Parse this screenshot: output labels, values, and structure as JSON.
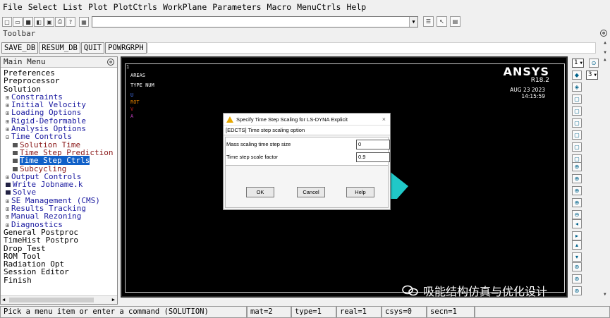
{
  "menubar": {
    "items": [
      "File",
      "Select",
      "List",
      "Plot",
      "PlotCtrls",
      "WorkPlane",
      "Parameters",
      "Macro",
      "MenuCtrls",
      "Help"
    ]
  },
  "toolbar": {
    "label": "Toolbar",
    "buttons": [
      "SAVE_DB",
      "RESUM_DB",
      "QUIT",
      "POWRGRPH"
    ]
  },
  "main_menu": {
    "title": "Main Menu",
    "items": [
      {
        "label": "Preferences",
        "level": 0
      },
      {
        "label": "Preprocessor",
        "level": 0
      },
      {
        "label": "Solution",
        "level": 0
      },
      {
        "label": "Constraints",
        "level": 1,
        "expandable": true
      },
      {
        "label": "Initial Velocity",
        "level": 1,
        "expandable": true
      },
      {
        "label": "Loading Options",
        "level": 1,
        "expandable": true
      },
      {
        "label": "Rigid-Deformable",
        "level": 1,
        "expandable": true
      },
      {
        "label": "Analysis Options",
        "level": 1,
        "expandable": true
      },
      {
        "label": "Time Controls",
        "level": 1,
        "expandable": true,
        "expanded": true
      },
      {
        "label": "Solution Time",
        "level": 2
      },
      {
        "label": "Time Step Prediction",
        "level": 2
      },
      {
        "label": "Time Step Ctrls",
        "level": 2,
        "selected": true
      },
      {
        "label": "Subcycling",
        "level": 2
      },
      {
        "label": "Output Controls",
        "level": 1,
        "expandable": true
      },
      {
        "label": "Write Jobname.k",
        "level": 1
      },
      {
        "label": "Solve",
        "level": 1
      },
      {
        "label": "SE Management (CMS)",
        "level": 1,
        "expandable": true
      },
      {
        "label": "Results Tracking",
        "level": 1,
        "expandable": true
      },
      {
        "label": "Manual Rezoning",
        "level": 1,
        "expandable": true
      },
      {
        "label": "Diagnostics",
        "level": 1,
        "expandable": true
      },
      {
        "label": "General Postproc",
        "level": 0
      },
      {
        "label": "TimeHist Postpro",
        "level": 0
      },
      {
        "label": "Drop Test",
        "level": 0
      },
      {
        "label": "ROM Tool",
        "level": 0
      },
      {
        "label": "Radiation Opt",
        "level": 0
      },
      {
        "label": "Session Editor",
        "level": 0
      },
      {
        "label": "Finish",
        "level": 0
      }
    ]
  },
  "graphics": {
    "window_number": "1",
    "plot_label": "AREAS",
    "type_label": "TYPE NUM",
    "legend": [
      {
        "text": "U",
        "color": "#4a7cff"
      },
      {
        "text": "ROT",
        "color": "#e08000"
      },
      {
        "text": "V",
        "color": "#d02020"
      },
      {
        "text": "A",
        "color": "#c040c0"
      }
    ],
    "product": "ANSYS",
    "release": "R18.2",
    "date": "AUG 23 2023",
    "time": "14:15:59",
    "shape_color": "#20c8c8"
  },
  "dialog": {
    "title": "Specify Time Step Scaling for LS-DYNA Explicit",
    "subtitle": "[EDCTS] Time step scaling option",
    "fields": [
      {
        "label": "Mass scaling time step size",
        "value": "0"
      },
      {
        "label": "Time step scale factor",
        "value": "0.9"
      }
    ],
    "buttons": [
      "OK",
      "Cancel",
      "Help"
    ]
  },
  "right_toolbar": {
    "window_select": "1",
    "view_select": "3"
  },
  "status": {
    "prompt": "Pick a menu item or enter a command (SOLUTION)",
    "mat": "mat=2",
    "type": "type=1",
    "real": "real=1",
    "csys": "csys=0",
    "secn": "secn=1"
  },
  "watermark": {
    "text": "吸能结构仿真与优化设计"
  }
}
